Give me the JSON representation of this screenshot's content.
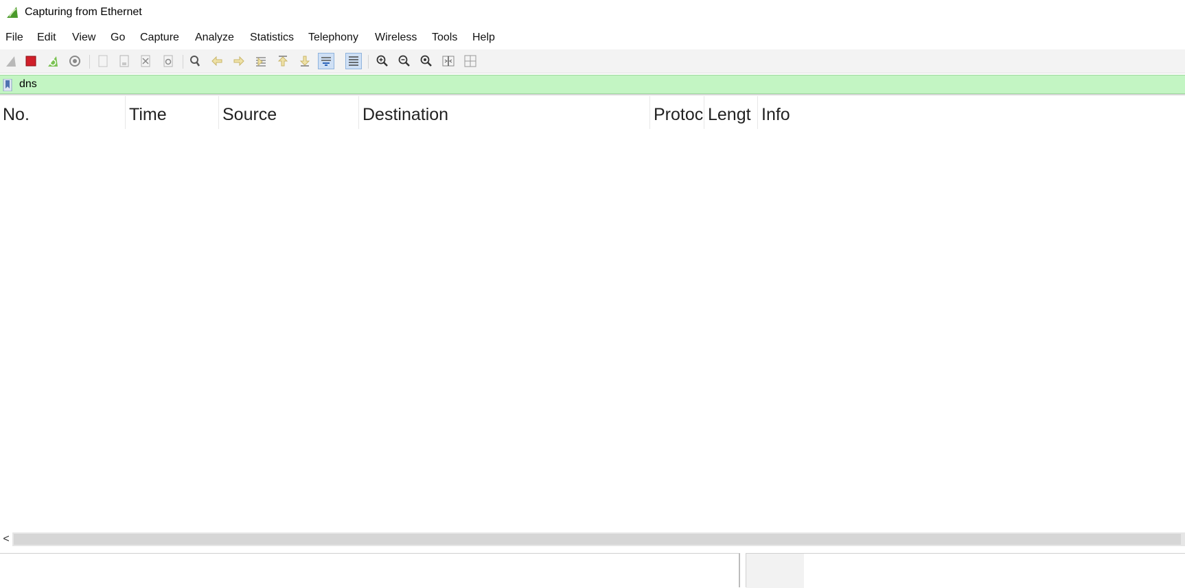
{
  "window": {
    "title": "Capturing from Ethernet"
  },
  "menu": [
    "File",
    "Edit",
    "View",
    "Go",
    "Capture",
    "Analyze",
    "Statistics",
    "Telephony",
    "Wireless",
    "Tools",
    "Help"
  ],
  "filter": {
    "value": "dns"
  },
  "columns": [
    "No.",
    "Time",
    "Source",
    "Destination",
    "Protoc",
    "Lengt",
    "Info"
  ],
  "scrollbar": {
    "left_arrow": "<"
  },
  "colors": {
    "filter_valid_bg": "#c3f5c3",
    "stop_red": "#d01f2a",
    "shark_green": "#4a9a2a"
  }
}
